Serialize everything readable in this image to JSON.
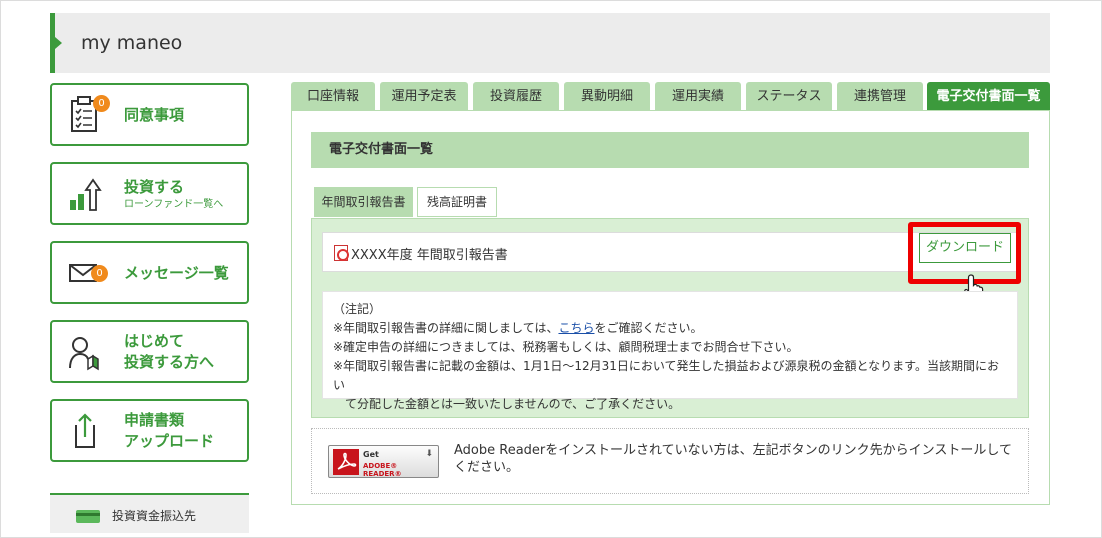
{
  "header": {
    "title": "my maneo"
  },
  "sidebar": {
    "items": [
      {
        "label": "同意事項",
        "badge": "0"
      },
      {
        "label": "投資する",
        "sub": "ローンファンド一覧へ"
      },
      {
        "label": "メッセージ一覧",
        "badge": "0"
      },
      {
        "label_line1": "はじめて",
        "label_line2": "投資する方へ"
      },
      {
        "label_line1": "申請書類",
        "label_line2": "アップロード"
      }
    ],
    "fund_label": "投資資金振込先"
  },
  "tabs": [
    {
      "label": "口座情報"
    },
    {
      "label": "運用予定表"
    },
    {
      "label": "投資履歴"
    },
    {
      "label": "異動明細"
    },
    {
      "label": "運用実績"
    },
    {
      "label": "ステータス"
    },
    {
      "label": "連携管理"
    },
    {
      "label": "電子交付書面一覧",
      "active": true
    }
  ],
  "section_title": "電子交付書面一覧",
  "subtabs": [
    {
      "label": "年間取引報告書",
      "active": true
    },
    {
      "label": "残高証明書"
    }
  ],
  "file": {
    "name": "XXXX年度 年間取引報告書",
    "download_label": "ダウンロード"
  },
  "notes": {
    "heading": "（注記）",
    "line1_pre": "※年間取引報告書の詳細に関しましては、",
    "line1_link": "こちら",
    "line1_post": "をご確認ください。",
    "line2": "※確定申告の詳細につきましては、税務署もしくは、顧問税理士までお問合せ下さい。",
    "line3a": "※年間取引報告書に記載の金額は、1月1日～12月31日において発生した損益および源泉税の金額となります。当該期間におい",
    "line3b": "て分配した金額とは一致いたしませんので、ご了承ください。"
  },
  "adobe": {
    "get": "Get",
    "reader": "ADOBE® READER®",
    "text": "Adobe Readerをインストールされていない方は、左記ボタンのリンク先からインストールしてください。"
  },
  "colors": {
    "accent": "#3c9a3c",
    "accent_light": "#b7dcb0",
    "highlight": "#e00000",
    "badge": "#f08a1c"
  }
}
